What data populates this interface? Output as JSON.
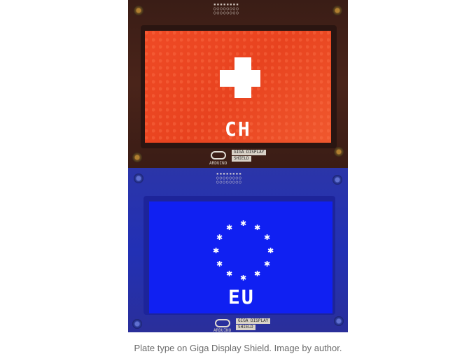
{
  "image": {
    "top_code": "CH",
    "bottom_code": "EU",
    "board_brand": "ARDUINO",
    "board_badge_line1": "GIGA DISPLAY",
    "board_badge_line2": "SHIELD"
  },
  "caption": "Plate type on Giga Display Shield. Image by author."
}
